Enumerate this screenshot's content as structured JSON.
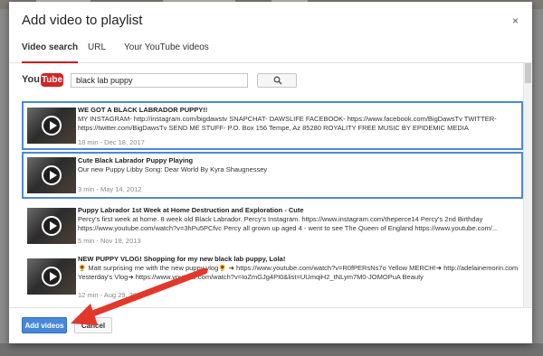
{
  "dialog": {
    "title": "Add video to playlist",
    "close_glyph": "×"
  },
  "tabs": [
    {
      "label": "Video search",
      "active": true
    },
    {
      "label": "URL",
      "active": false
    },
    {
      "label": "Your YouTube videos",
      "active": false
    }
  ],
  "search": {
    "logo_you": "You",
    "logo_tube": "Tube",
    "query": "black lab puppy",
    "button_icon": "search-icon"
  },
  "results": [
    {
      "title": "WE GOT A BLACK LABRADOR PUPPY!!",
      "description": "MY INSTAGRAM- http://instagram.com/bigdawstv SNAPCHAT- DAWSLIFE FACEBOOK- https://www.facebook.com/BigDawsTv TWITTER- https://twitter.com/BigDawsTv SEND ME STUFF- P.O. Box 156 Tempe, Az 85280 ROYALITY FREE MUSIC BY EPIDEMIC MEDIA",
      "meta": "18 min - Dec 18, 2017",
      "selected": true
    },
    {
      "title": "Cute Black Labrador Puppy Playing",
      "description": "Our new Puppy Libby Song: Dear World By Kyra Shaugnessey",
      "meta": "3 min - May 14, 2012",
      "selected": true
    },
    {
      "title": "Puppy Labrador 1st Week at Home Destruction and Exploration - Cute",
      "description": "Percy's first week at home. 8 week old Black Labrador. Percy's Instagram. https://www.instagram.com/theperce14 Percy's 2nd Birthday https://www.youtube.com/watch?v=3hPu5PCfvc Percy all grown up aged 4 - went to see The Queen of England https://www.youtube.com/...",
      "meta": "5 min - Nov 18, 2013",
      "selected": false
    },
    {
      "title": "NEW PUPPY VLOG! Shopping for my new black lab puppy, Lola!",
      "description": "🌻 Matt surprising me with the new puppy vlog🌻 ➜ https://www.youtube.com/watch?v=R0fPERsNs7o Yellow MERCH!➜ http://adelainemorin.com Yesterday's Vlog➜ https://www.youtube.com/watch?v=IoZmGJg4PI0&list=UUmqiH2_tNLym7M0-JOMOPuA Beauty",
      "meta": "12 min - Aug 29, 2018",
      "selected": false
    }
  ],
  "footer": {
    "add_label": "Add videos",
    "cancel_label": "Cancel"
  },
  "colors": {
    "selection_border": "#4d88d6",
    "primary_button": "#4788d9",
    "active_tab_underline": "#cc181e",
    "annotation_arrow": "#e2382b"
  }
}
